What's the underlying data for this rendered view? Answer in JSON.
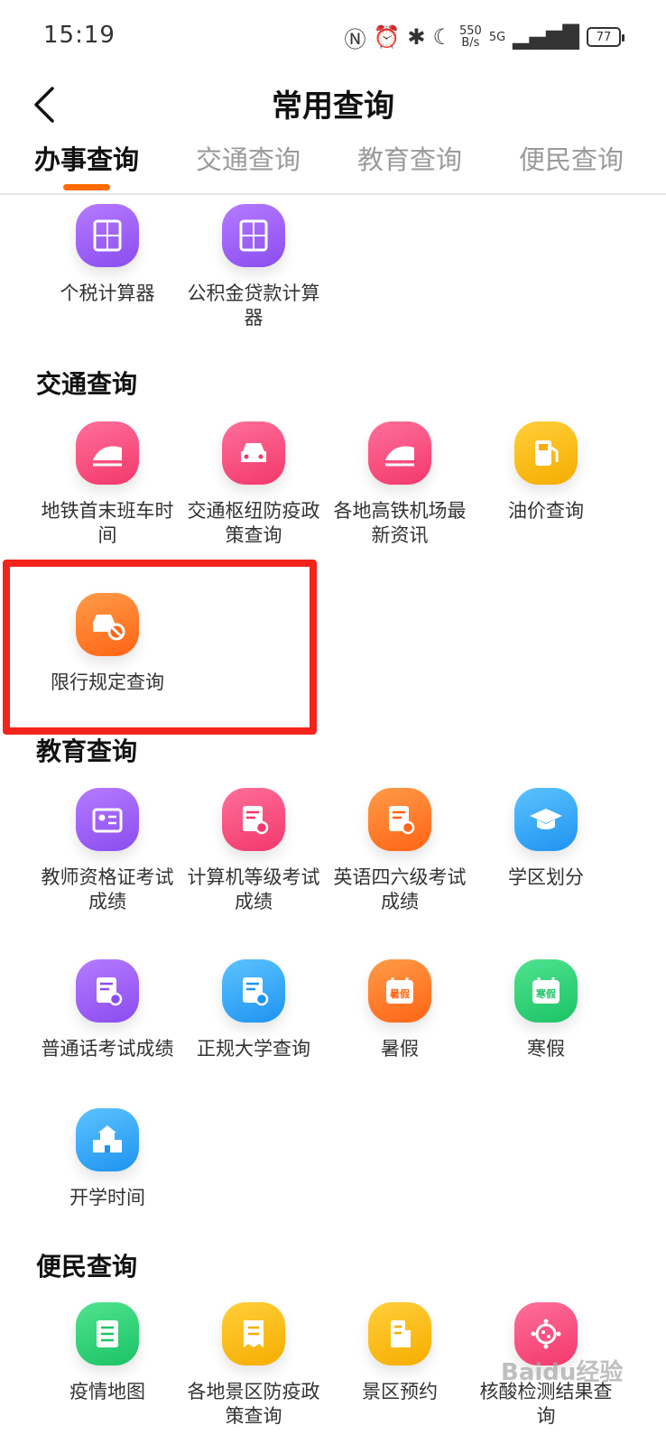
{
  "status": {
    "time": "15:19",
    "speed_top": "550",
    "speed_bottom": "B/s",
    "signal_label": "5G",
    "battery": "77"
  },
  "header": {
    "title": "常用查询"
  },
  "tabs": [
    {
      "label": "办事查询"
    },
    {
      "label": "交通查询"
    },
    {
      "label": "教育查询"
    },
    {
      "label": "便民查询"
    }
  ],
  "sections": {
    "top_items": [
      {
        "label": "个税计算器",
        "icon": "calculator-icon",
        "color": "#8b4cf0"
      },
      {
        "label": "公积金贷款计算器",
        "icon": "calculator-icon",
        "color": "#8b4cf0"
      }
    ],
    "traffic": {
      "title": "交通查询",
      "items": [
        {
          "label": "地铁首末班车时间",
          "icon": "train-icon",
          "color": "#f2386b"
        },
        {
          "label": "交通枢纽防疫政策查询",
          "icon": "car-icon",
          "color": "#f2386b"
        },
        {
          "label": "各地高铁机场最新资讯",
          "icon": "train-icon",
          "color": "#f2386b"
        },
        {
          "label": "油价查询",
          "icon": "fuel-pump-icon",
          "color": "#f6ad00"
        },
        {
          "label": "限行规定查询",
          "icon": "car-restricted-icon",
          "color": "#ff6414"
        }
      ]
    },
    "education": {
      "title": "教育查询",
      "items": [
        {
          "label": "教师资格证考试成绩",
          "icon": "id-card-icon",
          "color": "#8b4cf0"
        },
        {
          "label": "计算机等级考试成绩",
          "icon": "document-search-icon",
          "color": "#f2386b"
        },
        {
          "label": "英语四六级考试成绩",
          "icon": "document-search-icon",
          "color": "#ff6414"
        },
        {
          "label": "学区划分",
          "icon": "graduation-cap-icon",
          "color": "#1e93f0"
        },
        {
          "label": "普通话考试成绩",
          "icon": "document-search-icon",
          "color": "#8b4cf0"
        },
        {
          "label": "正规大学查询",
          "icon": "document-search-icon",
          "color": "#1e93f0"
        },
        {
          "label": "暑假",
          "icon": "summer-calendar-icon",
          "color": "#ff6414",
          "badge": "暑假"
        },
        {
          "label": "寒假",
          "icon": "winter-calendar-icon",
          "color": "#1cc365",
          "badge": "寒假"
        },
        {
          "label": "开学时间",
          "icon": "school-building-icon",
          "color": "#1e93f0"
        }
      ]
    },
    "convenience": {
      "title": "便民查询",
      "items": [
        {
          "label": "疫情地图",
          "icon": "list-icon",
          "color": "#1cc365"
        },
        {
          "label": "各地景区防疫政策查询",
          "icon": "receipt-icon",
          "color": "#f6ad00"
        },
        {
          "label": "景区预约",
          "icon": "building-icon",
          "color": "#f6ad00"
        },
        {
          "label": "核酸检测结果查询",
          "icon": "virus-icon",
          "color": "#f2386b"
        }
      ]
    }
  },
  "watermark": "Baidu经验"
}
